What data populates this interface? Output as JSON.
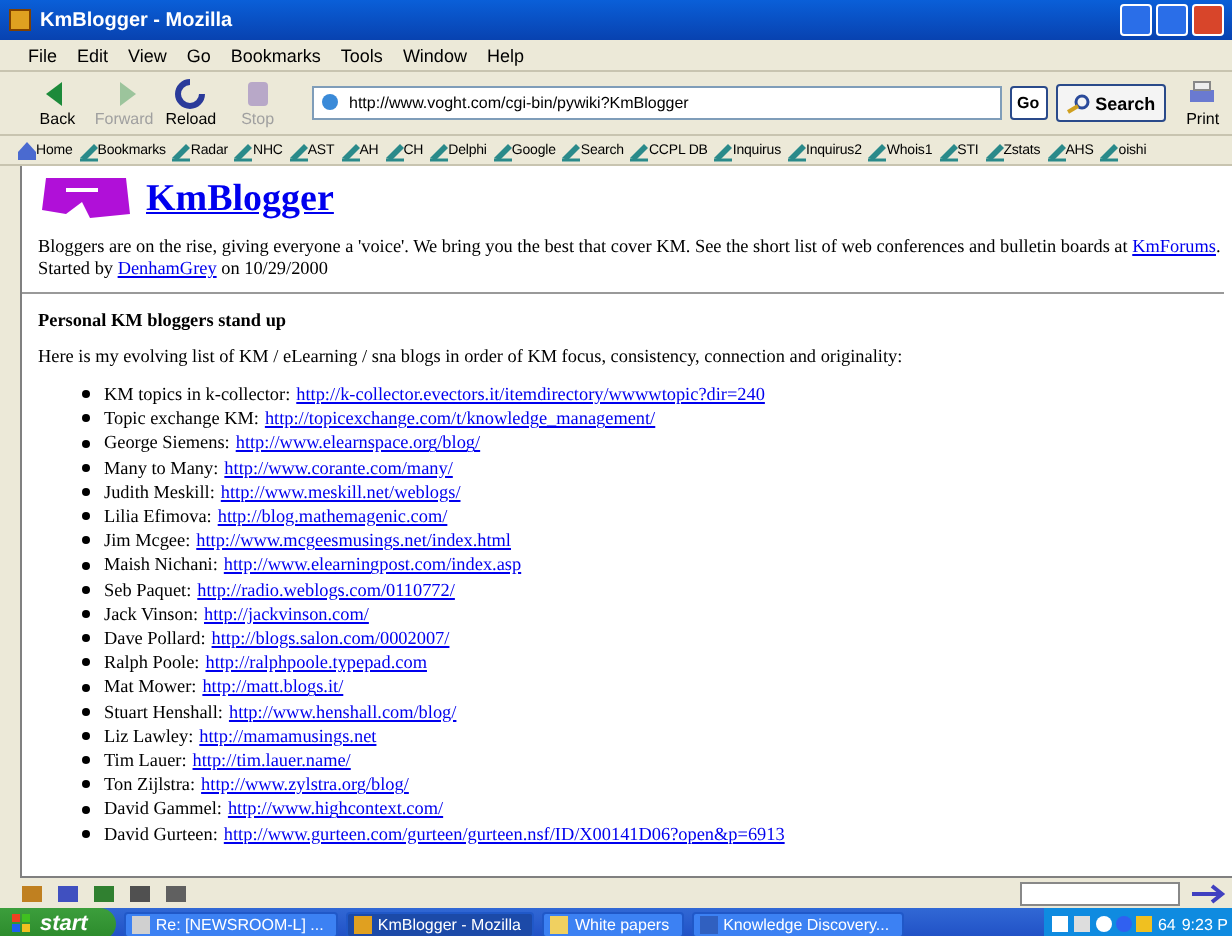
{
  "window": {
    "title": "KmBlogger - Mozilla"
  },
  "menu": [
    "File",
    "Edit",
    "View",
    "Go",
    "Bookmarks",
    "Tools",
    "Window",
    "Help"
  ],
  "nav_buttons": [
    {
      "label": "Back",
      "disabled": false
    },
    {
      "label": "Forward",
      "disabled": true
    },
    {
      "label": "Reload",
      "disabled": false
    },
    {
      "label": "Stop",
      "disabled": true
    }
  ],
  "address": {
    "value": "http://www.voght.com/cgi-bin/pywiki?KmBlogger"
  },
  "go_button": "Go",
  "search_button": "Search",
  "print_button": "Print",
  "bookmarks": [
    "Home",
    "Bookmarks",
    "Radar",
    "NHC",
    "AST",
    "AH",
    "CH",
    "Delphi",
    "Google",
    "Search",
    "CCPL DB",
    "Inquirus",
    "Inquirus2",
    "Whois1",
    "STI",
    "Zstats",
    "AHS",
    "oishi"
  ],
  "page": {
    "title": "KmBlogger",
    "intro": "Bloggers are on the rise, giving everyone a 'voice'. We bring you the best that cover KM. See the short list of web conferences and bulletin boards at ",
    "intro_link": "KmForums",
    "intro_end": ".",
    "started": "Started by ",
    "started_link": "DenhamGrey",
    "started_date": " on 10/29/2000",
    "heading": "Personal KM bloggers stand up",
    "lead": "Here is my evolving list of KM / eLearning / sna blogs in order of KM focus, consistency, connection and originality:",
    "blogs": [
      {
        "name": "KM topics in k-collector:",
        "url": "http://k-collector.evectors.it/itemdirectory/wwwwtopic?dir=240"
      },
      {
        "name": "Topic exchange KM:",
        "url": "http://topicexchange.com/t/knowledge_management/"
      },
      {
        "name": "George Siemens:",
        "url": "http://www.elearnspace.org/blog/"
      },
      {
        "name": "Many to Many:",
        "url": "http://www.corante.com/many/"
      },
      {
        "name": "Judith Meskill:",
        "url": "http://www.meskill.net/weblogs/"
      },
      {
        "name": "Lilia Efimova:",
        "url": "http://blog.mathemagenic.com/"
      },
      {
        "name": "Jim Mcgee:",
        "url": "http://www.mcgeesmusings.net/index.html"
      },
      {
        "name": "Maish Nichani:",
        "url": "http://www.elearningpost.com/index.asp"
      },
      {
        "name": "Seb Paquet:",
        "url": "http://radio.weblogs.com/0110772/"
      },
      {
        "name": "Jack Vinson:",
        "url": "http://jackvinson.com/"
      },
      {
        "name": "Dave Pollard:",
        "url": "http://blogs.salon.com/0002007/"
      },
      {
        "name": "Ralph Poole:",
        "url": "http://ralphpoole.typepad.com"
      },
      {
        "name": "Mat Mower:",
        "url": "http://matt.blogs.it/"
      },
      {
        "name": "Stuart Henshall:",
        "url": "http://www.henshall.com/blog/"
      },
      {
        "name": "Liz Lawley:",
        "url": "http://mamamusings.net"
      },
      {
        "name": "Tim Lauer:",
        "url": "http://tim.lauer.name/"
      },
      {
        "name": "Ton Zijlstra:",
        "url": "http://www.zylstra.org/blog/"
      },
      {
        "name": "David Gammel:",
        "url": "http://www.highcontext.com/"
      },
      {
        "name": "David Gurteen:",
        "url": "http://www.gurteen.com/gurteen/gurteen.nsf/ID/X00141D06?open&p=6913"
      }
    ]
  },
  "taskbar": {
    "start": "start",
    "tasks": [
      {
        "label": "Re: [NEWSROOM-L] ...",
        "selected": false
      },
      {
        "label": "KmBlogger - Mozilla",
        "selected": true
      },
      {
        "label": "White papers",
        "selected": false
      },
      {
        "label": "Knowledge Discovery...",
        "selected": false
      }
    ],
    "tray_text": "64",
    "clock": "9:23 P"
  }
}
